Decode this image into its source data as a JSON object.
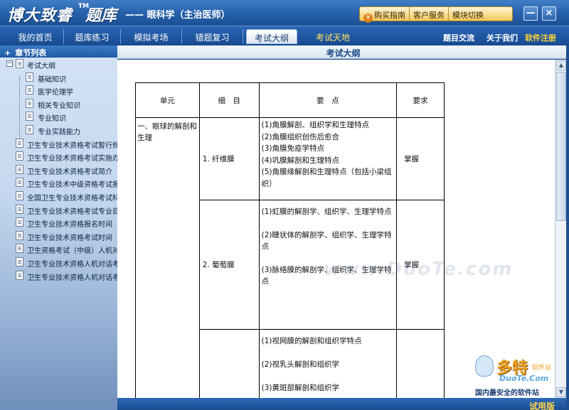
{
  "app": {
    "name": "博大致睿",
    "tm": "TM",
    "product": "题库",
    "subject": "—— 眼科学（主治医师）"
  },
  "top_buttons": [
    {
      "label": "购买指南",
      "icon": "cart-icon"
    },
    {
      "label": "客户服务"
    },
    {
      "label": "模块切换"
    }
  ],
  "window_controls": {
    "minimize": "—",
    "close": "×"
  },
  "nav": {
    "tabs": [
      "我的首页",
      "题库练习",
      "模拟考场",
      "错题复习",
      "考试大纲",
      "考试天地"
    ],
    "active_tab": "考试大纲",
    "links": [
      "题目交流",
      "关于我们",
      "软件注册"
    ]
  },
  "sidebar": {
    "header": "章节列表",
    "root": "考试大纲",
    "children": [
      "基础知识",
      "医学伦理学",
      "相关专业知识",
      "专业知识",
      "专业实践能力"
    ],
    "items": [
      "卫生专业技术资格考试暂行规",
      "卫生专业技术资格考试实施办",
      "卫生专业技术资格考试简介",
      "卫生专业技术中级资格考试报",
      "全国卫生专业技术资格考试科",
      "卫生专业技术资格考试专业目",
      "卫生专业技术资格报名时间",
      "卫生专业技术资格考试时间",
      "卫生资格考试（中级）人机对话",
      "卫生专业技术资格人机对话考",
      "卫生专业技术资格人机对话考"
    ]
  },
  "main": {
    "header": "考试大纲",
    "table": {
      "headers": [
        "单元",
        "细　目",
        "要　点",
        "要求"
      ],
      "unit": "一、眼球的解剖和生理",
      "rows": [
        {
          "detail": "1. 纤维膜",
          "points": [
            "(1)角膜解剖、组织学和生理特点",
            "(2)角膜组织创伤后愈合",
            "(3)角膜免疫学特点",
            "(4)巩膜解剖和生理特点",
            "(5)角膜缘解剖和生理特点（包括小梁组织）"
          ],
          "requirement": "掌握"
        },
        {
          "detail": "2. 葡萄膜",
          "points": [
            "(1)虹膜的解剖学、组织学、生理学特点",
            "(2)睫状体的解剖学、组织学、生理学特点",
            "(3)脉络膜的解剖学、组织学、生理学特点"
          ],
          "requirement": "掌握"
        },
        {
          "detail": "",
          "points": [
            "(1)视网膜的解剖和组织学特点",
            "(2)视乳头解剖和组织学",
            "(3)黄斑部解剖和组织学"
          ],
          "requirement": ""
        }
      ]
    }
  },
  "watermarks": {
    "center": "www.DuoTe.com",
    "logo_big": "多特",
    "logo_small": "软件站",
    "logo_url": "DuoTe.Com",
    "slogan": "国内最安全的软件站"
  },
  "status": {
    "trial": "试用版"
  }
}
